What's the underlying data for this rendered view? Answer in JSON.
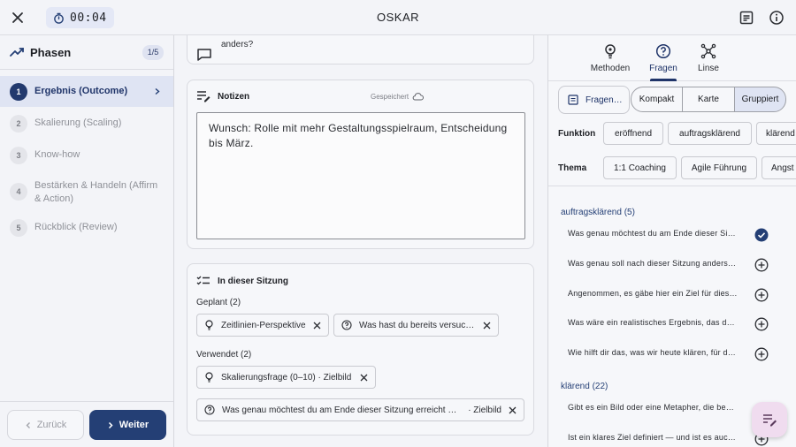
{
  "app": {
    "title": "OSKAR",
    "timer": "00:04"
  },
  "phases": {
    "title": "Phasen",
    "count": "1/5",
    "items": [
      {
        "num": "1",
        "label": "Ergebnis (Outcome)",
        "active": true
      },
      {
        "num": "2",
        "label": "Skalierung (Scaling)"
      },
      {
        "num": "3",
        "label": "Know-how"
      },
      {
        "num": "4",
        "label": "Bestärken & Handeln (Affirm & Action)"
      },
      {
        "num": "5",
        "label": "Rückblick (Review)"
      }
    ],
    "back_label": "Zurück",
    "next_label": "Weiter"
  },
  "question_card": {
    "line1": "anders?"
  },
  "notes": {
    "title": "Notizen",
    "saved": "Gespeichert",
    "text": "Wunsch: Rolle mit mehr Gestaltungsspielraum, Entscheidung bis März."
  },
  "session": {
    "title": "In dieser Sitzung",
    "planned_label": "Geplant (2)",
    "planned": [
      "Zeitlinien-Perspektive",
      "Was hast du bereits versucht?"
    ],
    "used_label": "Verwendet (2)",
    "used": [
      {
        "text": "Skalierungsfrage (0–10) · Zielbild"
      },
      {
        "text": "Was genau möchtest du am Ende dieser Sitzung erreicht haben",
        "suffix": "· Zielbild"
      }
    ]
  },
  "right": {
    "tabs": [
      "Methoden",
      "Fragen",
      "Linse"
    ],
    "active_tab": "Fragen",
    "view_dropdown": "Fragen…",
    "view_options": [
      "Kompakt",
      "Karte",
      "Gruppiert"
    ],
    "funktion_label": "Funktion",
    "funktion_chips": [
      "eröffnend",
      "auftragsklärend",
      "klärend"
    ],
    "thema_label": "Thema",
    "thema_chips": [
      "1:1 Coaching",
      "Agile Führung",
      "Angst"
    ],
    "group1": {
      "title": "auftragsklärend (5)",
      "questions": [
        {
          "text": "Was genau möchtest du am Ende dieser Sitzung erreicht haben?",
          "state": "added"
        },
        {
          "text": "Was genau soll nach dieser Sitzung anders sein?",
          "state": "add"
        },
        {
          "text": "Angenommen, es gäbe hier ein Ziel für diese Sitzung – welches wäre es?",
          "state": "add"
        },
        {
          "text": "Was wäre ein realistisches Ergebnis, das du heute mitnehmen möchtest?",
          "state": "add"
        },
        {
          "text": "Wie hilft dir das, was wir heute klären, für deinen nächsten Schritt?",
          "state": "add"
        }
      ]
    },
    "group2": {
      "title": "klärend (22)",
      "questions": [
        {
          "text": "Gibt es ein Bild oder eine Metapher, die beschreibt, wo du stehst?",
          "state": "add"
        },
        {
          "text": "Ist ein klares Ziel definiert — und ist es auch deines?",
          "state": "add"
        }
      ]
    }
  },
  "colors": {
    "primary": "#243f75",
    "accent_bg": "#dfe4f3",
    "fab_bg": "#f0dcef"
  }
}
